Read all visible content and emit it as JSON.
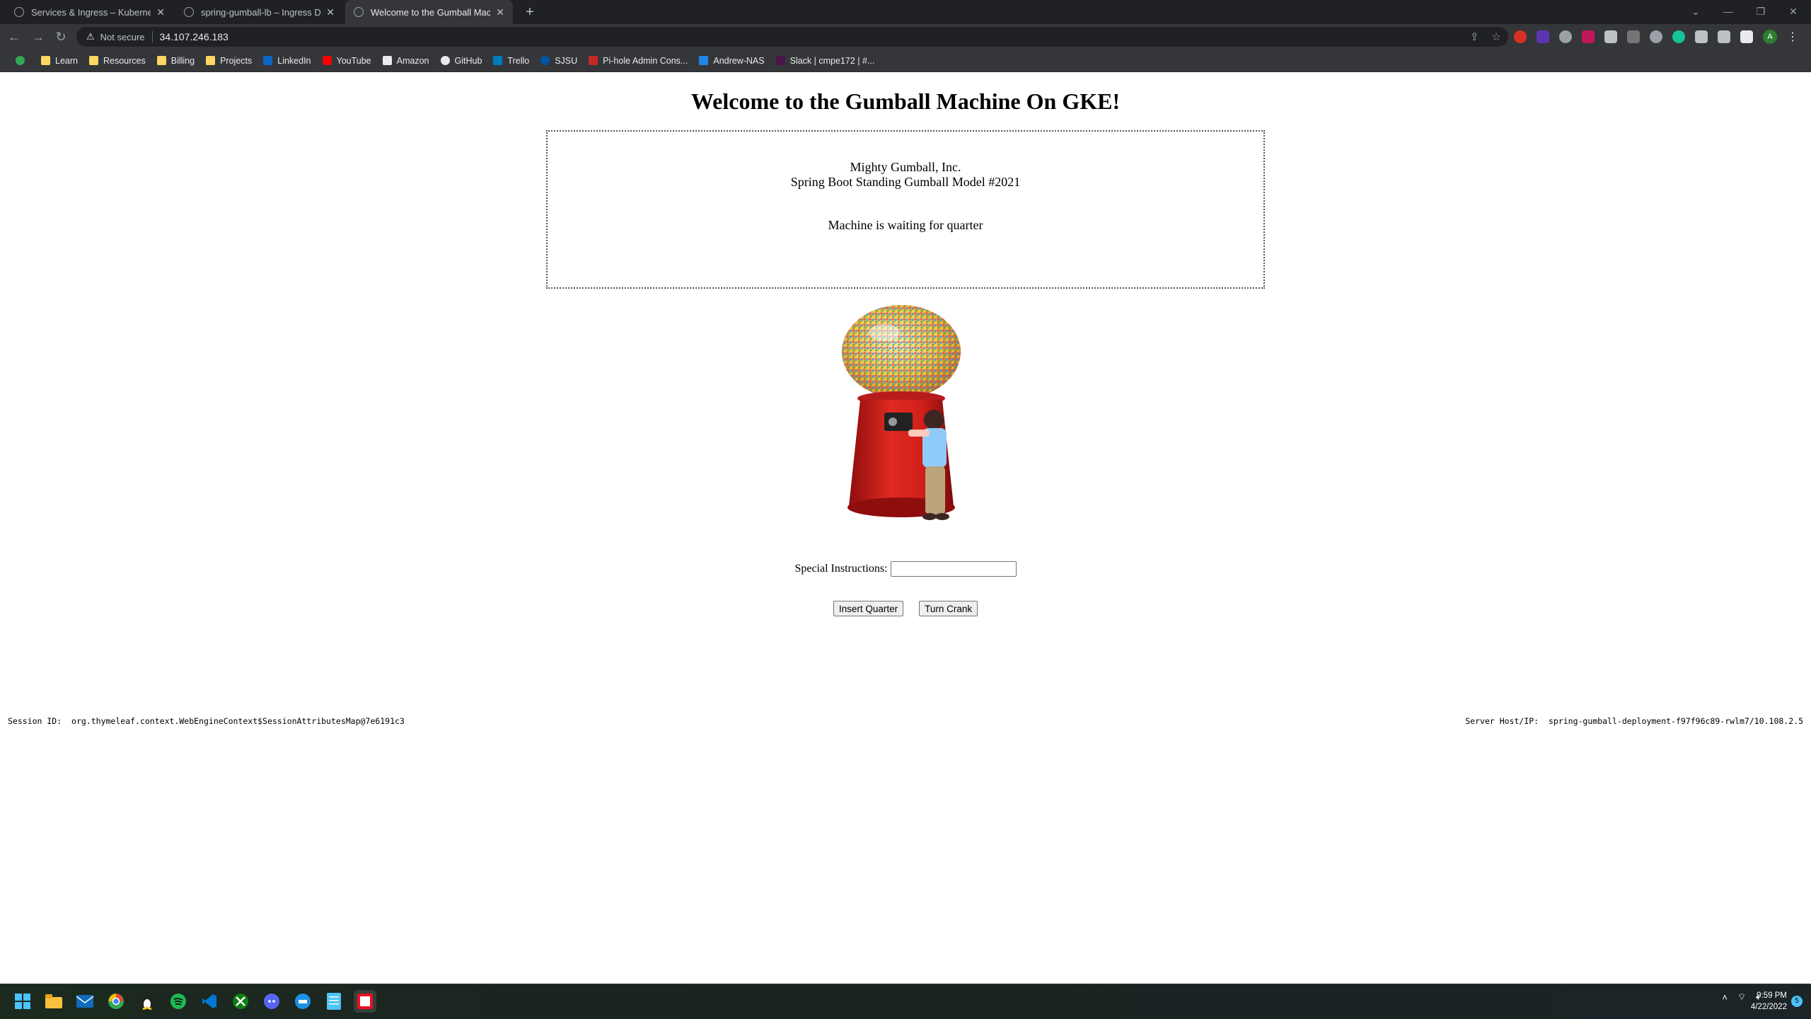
{
  "browser": {
    "tabs": [
      {
        "title": "Services & Ingress – Kubernetes",
        "active": false
      },
      {
        "title": "spring-gumball-lb – Ingress Deta",
        "active": false
      },
      {
        "title": "Welcome to the Gumball Machin",
        "active": true
      }
    ],
    "new_tab": "+",
    "security_label": "Not secure",
    "url": "34.107.246.183",
    "bookmarks": [
      {
        "label": "Learn",
        "icon": "folder-icon"
      },
      {
        "label": "Resources",
        "icon": "folder-icon"
      },
      {
        "label": "Billing",
        "icon": "folder-icon"
      },
      {
        "label": "Projects",
        "icon": "folder-icon"
      },
      {
        "label": "LinkedIn",
        "icon": "linkedin-icon"
      },
      {
        "label": "YouTube",
        "icon": "youtube-icon"
      },
      {
        "label": "Amazon",
        "icon": "amazon-icon"
      },
      {
        "label": "GitHub",
        "icon": "github-icon"
      },
      {
        "label": "Trello",
        "icon": "trello-icon"
      },
      {
        "label": "SJSU",
        "icon": "sjsu-icon"
      },
      {
        "label": "Pi-hole Admin Cons...",
        "icon": "pihole-icon"
      },
      {
        "label": "Andrew-NAS",
        "icon": "nas-icon"
      },
      {
        "label": "Slack | cmpe172 | #...",
        "icon": "slack-icon"
      }
    ],
    "profile_initial": "A"
  },
  "page": {
    "heading": "Welcome to the Gumball Machine On GKE!",
    "company": "Mighty Gumball, Inc.",
    "model": "Spring Boot Standing Gumball Model #2021",
    "state": "Machine is waiting for quarter",
    "instructions_label": "Special Instructions:",
    "instructions_value": "",
    "insert_button": "Insert Quarter",
    "crank_button": "Turn Crank",
    "session_label": "Session ID:",
    "session_value": "org.thymeleaf.context.WebEngineContext$SessionAttributesMap@7e6191c3",
    "server_label": "Server Host/IP:",
    "server_value": "spring-gumball-deployment-f97f96c89-rwlm7/10.108.2.5"
  },
  "taskbar": {
    "time": "9:59 PM",
    "date": "4/22/2022",
    "notifications": "5"
  }
}
